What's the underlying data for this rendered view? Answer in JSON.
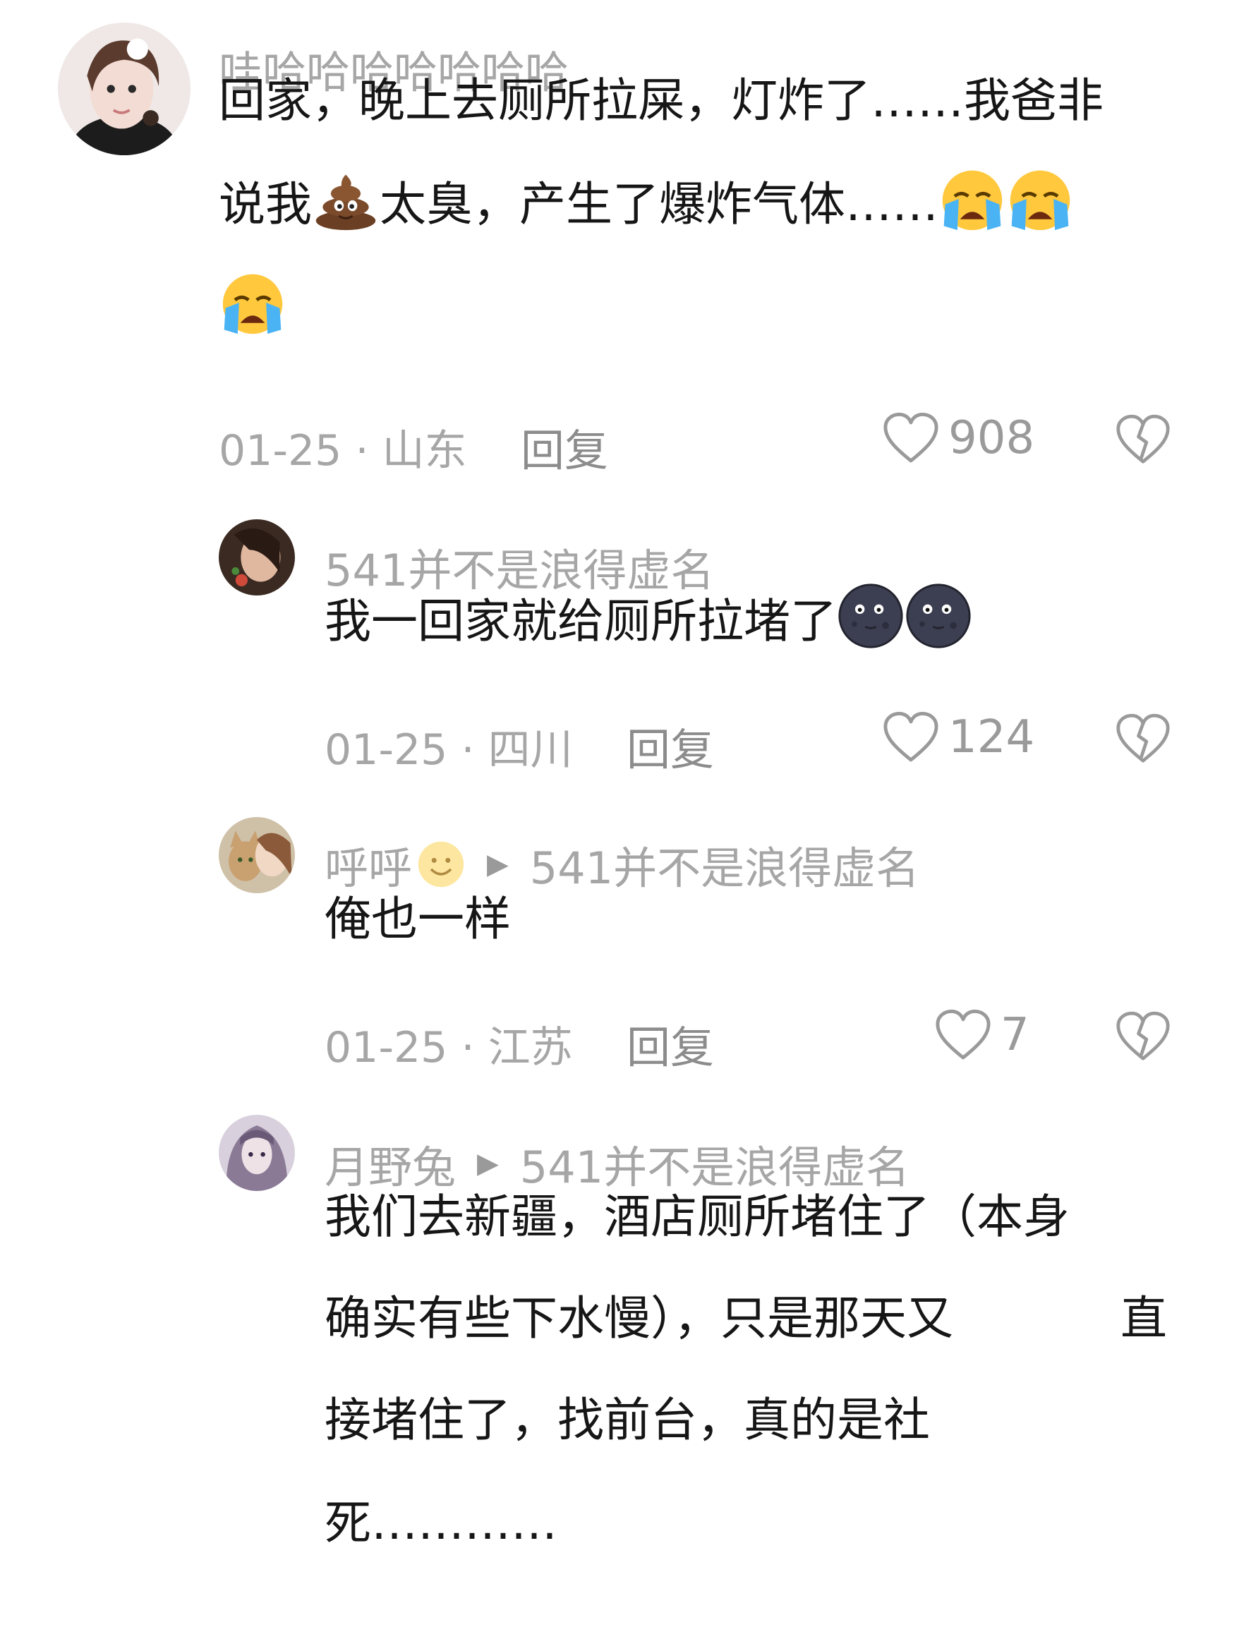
{
  "comments": [
    {
      "username": "哇哈哈哈哈哈哈哈",
      "text_lines": [
        "回家，晚上去厕所拉屎，灯炸了……我爸非",
        "说我",
        "太臭，产生了爆炸气体……"
      ],
      "date": "01-25",
      "location": "山东",
      "reply_label": "回复",
      "likes": "908"
    },
    {
      "username": "541并不是浪得虚名",
      "text_lines": [
        "我一回家就给厕所拉堵了"
      ],
      "date": "01-25",
      "location": "四川",
      "reply_label": "回复",
      "likes": "124"
    },
    {
      "username": "呼呼",
      "reply_to": "541并不是浪得虚名",
      "text_lines": [
        "俺也一样"
      ],
      "date": "01-25",
      "location": "江苏",
      "reply_label": "回复",
      "likes": "7"
    },
    {
      "username": "月野兔",
      "reply_to": "541并不是浪得虚名",
      "text_lines": [
        "我们去新疆，酒店厕所堵住了（本身",
        "确实有些下水慢），只是那天又",
        "直",
        "接堵住了，找前台，真的是社",
        "死…………"
      ]
    }
  ],
  "separator": "·",
  "icons": {
    "like": "heart-outline-icon",
    "dislike": "broken-heart-icon",
    "poop": "poop-emoji-icon",
    "crying": "loudly-crying-face-emoji-icon",
    "dark_moon": "new-moon-face-emoji-icon",
    "smile": "smiling-face-emoji-icon",
    "reply_arrow": "reply-arrow-icon"
  },
  "colors": {
    "username": "#a6a6a6",
    "text": "#161616",
    "meta": "#a6a6a6",
    "background": "#ffffff"
  }
}
